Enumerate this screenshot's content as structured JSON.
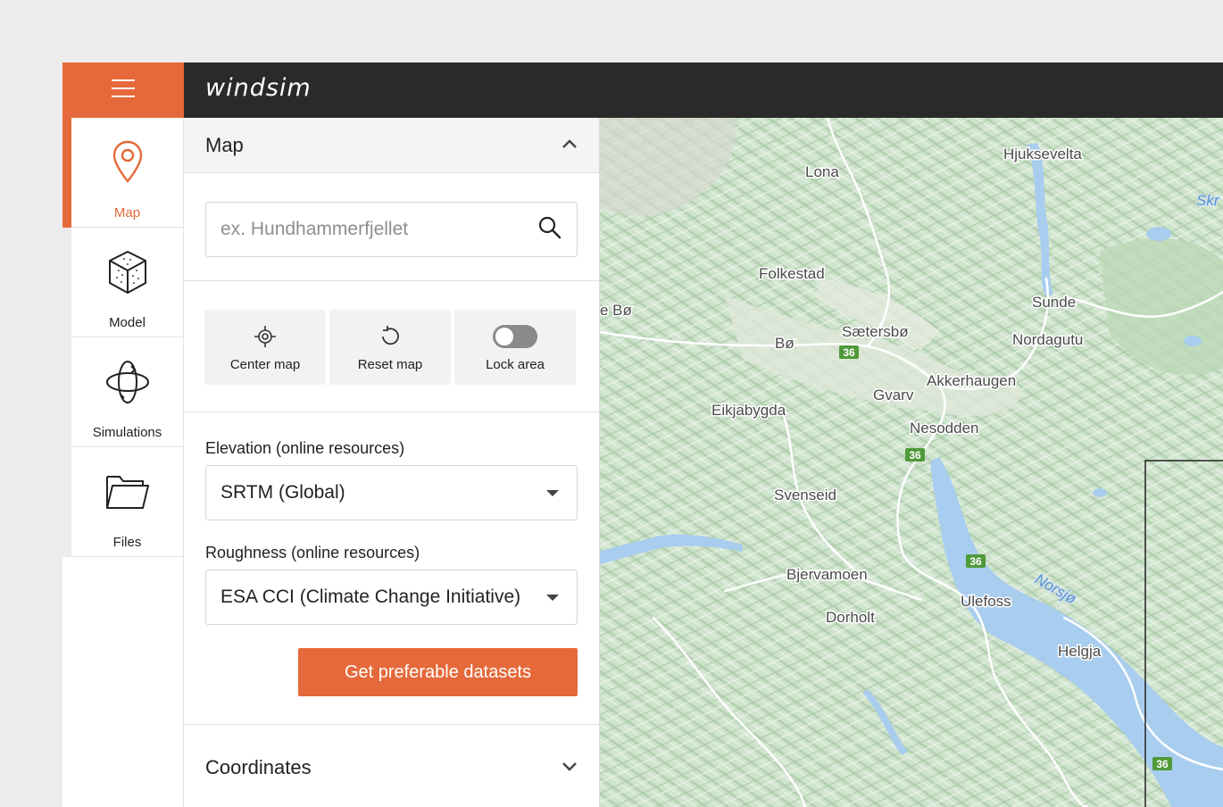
{
  "app": {
    "logo": "windsim"
  },
  "icons": {
    "menu": "hamburger-icon",
    "map": "map-pin-icon",
    "model": "cube-icon",
    "simulations": "orbit-icon",
    "files": "folder-icon",
    "search": "search-icon",
    "center": "crosshair-icon",
    "reset": "refresh-icon",
    "collapse": "chevron-up-icon",
    "expand": "chevron-down-icon"
  },
  "colors": {
    "accent": "#e5693a",
    "topbar": "#2a2a2a",
    "water": "#a9cdee",
    "terrain": "#cfe4cc"
  },
  "nav": {
    "items": [
      {
        "label": "Map",
        "active": true
      },
      {
        "label": "Model",
        "active": false
      },
      {
        "label": "Simulations",
        "active": false
      },
      {
        "label": "Files",
        "active": false
      }
    ]
  },
  "panel": {
    "title": "Map",
    "search": {
      "placeholder": "ex. Hundhammerfjellet",
      "value": ""
    },
    "tools": [
      {
        "label": "Center map"
      },
      {
        "label": "Reset map"
      },
      {
        "label": "Lock area",
        "toggle_on": false
      }
    ],
    "elevation": {
      "label": "Elevation (online resources)",
      "value": "SRTM (Global)"
    },
    "roughness": {
      "label": "Roughness (online resources)",
      "value": "ESA CCI (Climate Change Initiative)"
    },
    "button_label": "Get preferable datasets",
    "coordinates": {
      "title": "Coordinates"
    }
  },
  "map": {
    "places": [
      "Hjuksevelta",
      "Skr",
      "Lona",
      "Folkestad",
      "Sunde",
      "e Bø",
      "Sætersbø",
      "Nordagutu",
      "Bø",
      "Akkerhaugen",
      "Gvarv",
      "Eikjabygda",
      "Nesodden",
      "Svenseid",
      "Bjervamoen",
      "Ulefoss",
      "Dorholt",
      "Helgja"
    ],
    "lake": "Norsjø",
    "route_number": "36"
  }
}
